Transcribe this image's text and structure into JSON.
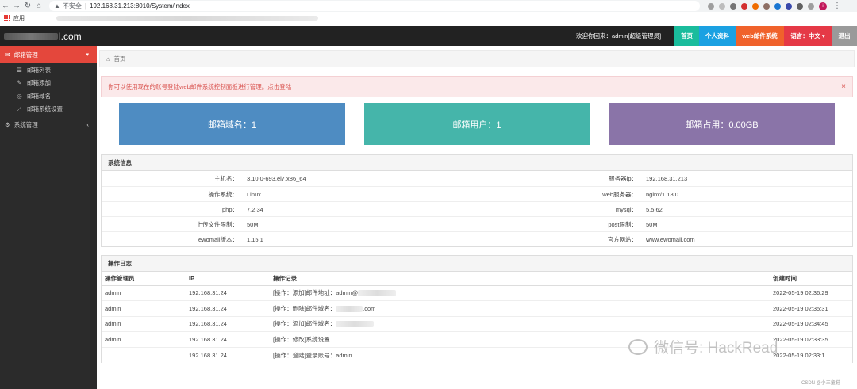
{
  "browser": {
    "insecure_label": "不安全",
    "url": "192.168.31.213:8010/System/index",
    "apps_label": "应用",
    "profile_initial": "i"
  },
  "header": {
    "logo_suffix": "l.com",
    "welcome": "欢迎你回来：admin[超级管理员]",
    "home": "首页",
    "profile": "个人资料",
    "webmail": "web邮件系统",
    "lang": "语言：中文 ▾",
    "logout": "退出"
  },
  "sidebar": {
    "mail_manage": "邮箱管理",
    "items": [
      {
        "label": "邮箱列表",
        "icon": "list-icon"
      },
      {
        "label": "邮箱添加",
        "icon": "pencil-icon"
      },
      {
        "label": "邮箱域名",
        "icon": "globe-icon"
      },
      {
        "label": "邮箱系统设置",
        "icon": "wrench-icon"
      }
    ],
    "system_manage": "系统管理"
  },
  "breadcrumb": {
    "home": "首页"
  },
  "alert": {
    "text": "你可以使用现在的账号登陆web邮件系统控制面板进行管理。点击登陆",
    "close": "×"
  },
  "stats": {
    "domains": "邮箱域名：1",
    "users": "邮箱用户：1",
    "usage": "邮箱占用：0.00GB"
  },
  "sysinfo": {
    "title": "系统信息",
    "rows": [
      {
        "k1": "主机名：",
        "v1": "3.10.0-693.el7.x86_64",
        "k2": "服务器ip：",
        "v2": "192.168.31.213"
      },
      {
        "k1": "操作系统：",
        "v1": "Linux",
        "k2": "web服务器：",
        "v2": "nginx/1.18.0"
      },
      {
        "k1": "php：",
        "v1": "7.2.34",
        "k2": "mysql：",
        "v2": "5.5.62"
      },
      {
        "k1": "上传文件限制：",
        "v1": "50M",
        "k2": "post限制：",
        "v2": "50M"
      },
      {
        "k1": "ewomail版本：",
        "v1": "1.15.1",
        "k2": "官方网站：",
        "v2": "www.ewomail.com"
      }
    ]
  },
  "oplog": {
    "title": "操作日志",
    "headers": [
      "操作管理员",
      "IP",
      "操作记录",
      "创建时间"
    ],
    "rows": [
      {
        "admin": "admin",
        "ip": "192.168.31.24",
        "record": "[操作：添加]邮件地址：admin@",
        "suffix": "",
        "time": "2022-05-19 02:36:29"
      },
      {
        "admin": "admin",
        "ip": "192.168.31.24",
        "record": "[操作：删除]邮件域名：",
        "suffix": ".com",
        "time": "2022-05-19 02:35:31"
      },
      {
        "admin": "admin",
        "ip": "192.168.31.24",
        "record": "[操作：添加]邮件域名：",
        "suffix": "",
        "time": "2022-05-19 02:34:45"
      },
      {
        "admin": "admin",
        "ip": "192.168.31.24",
        "record": "[操作：修改]系统设置",
        "suffix": "",
        "time": "2022-05-19 02:33:35"
      },
      {
        "admin": "",
        "ip": "192.168.31.24",
        "record": "[操作：登陆]登录账号：admin",
        "suffix": "",
        "time": "2022-05-19 02:33:1"
      }
    ]
  },
  "watermark": {
    "text": "微信号: HackRead"
  },
  "csdn": {
    "text": "CSDN @小王童鞋-"
  }
}
